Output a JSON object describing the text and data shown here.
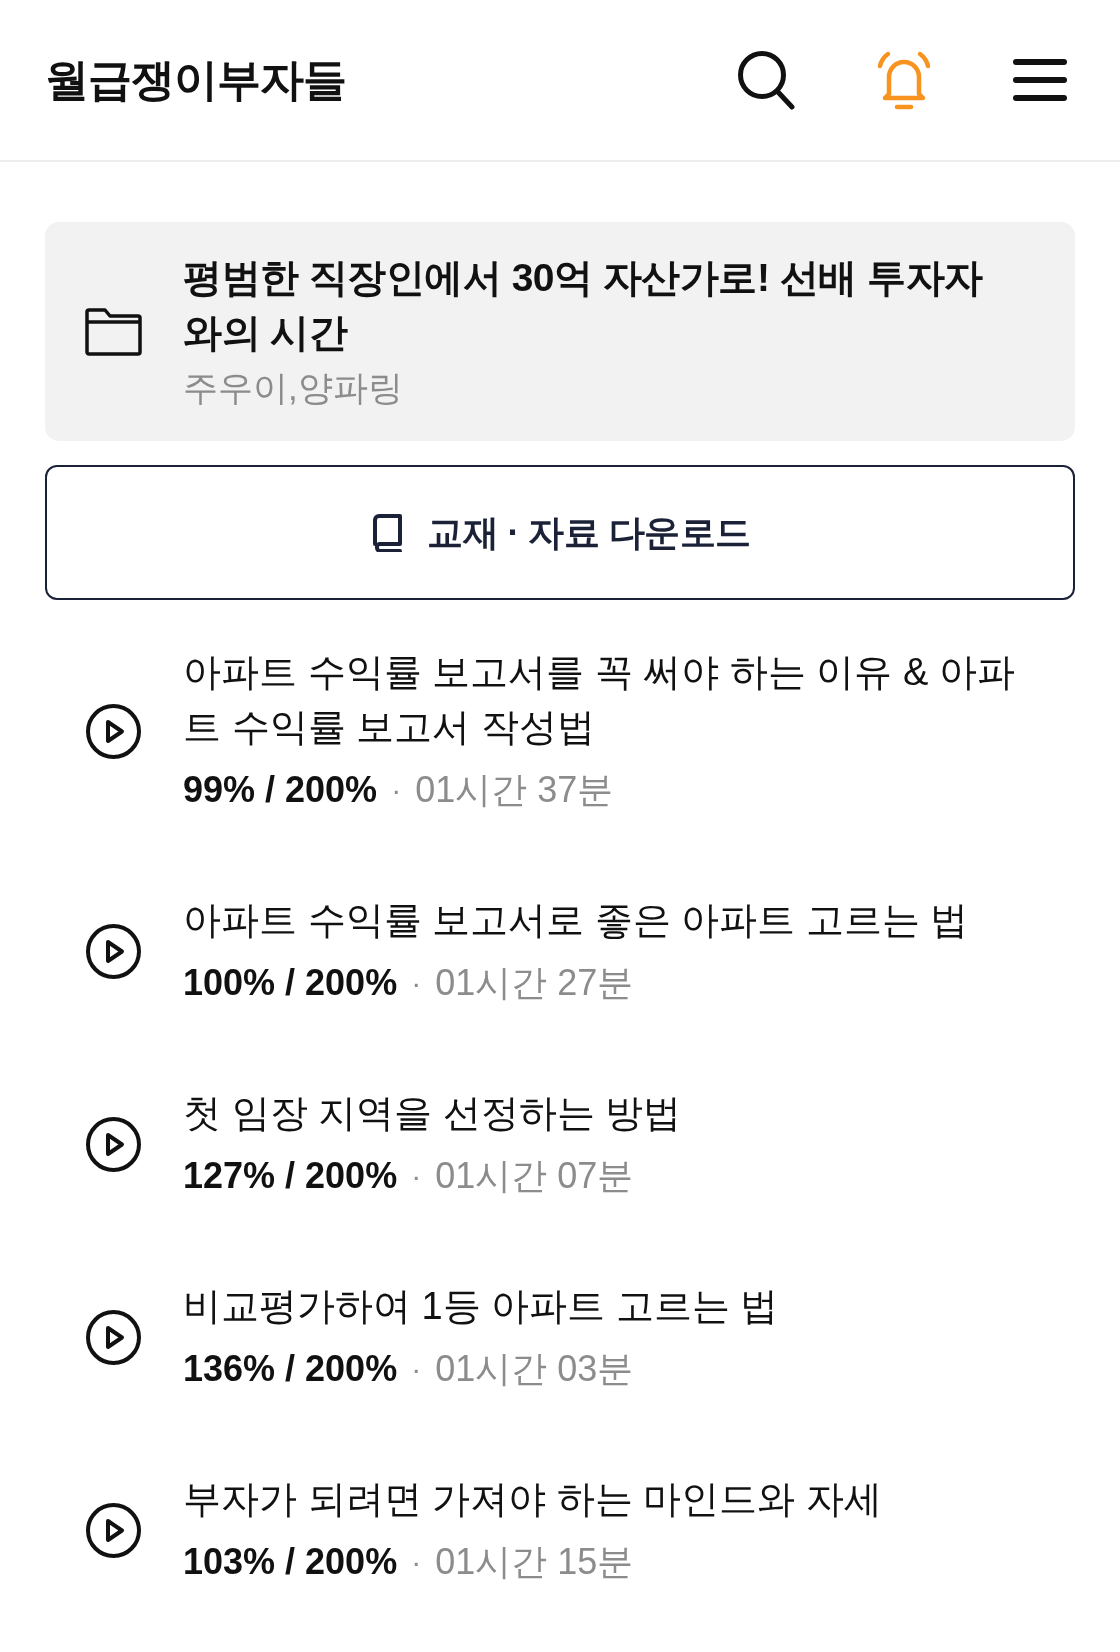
{
  "header": {
    "logo": "월급쟁이부자들"
  },
  "course": {
    "title": "평범한 직장인에서 30억 자산가로! 선배 투자자와의 시간",
    "instructors": "주우이,양파링"
  },
  "download_button": {
    "label": "교재 · 자료 다운로드"
  },
  "lessons": [
    {
      "title": "아파트 수익률 보고서를 꼭 써야 하는 이유 & 아파트 수익률 보고서 작성법",
      "progress": "99% / 200%",
      "separator": "·",
      "duration": "01시간 37분"
    },
    {
      "title": "아파트 수익률 보고서로 좋은 아파트 고르는 법",
      "progress": "100% / 200%",
      "separator": "·",
      "duration": "01시간 27분"
    },
    {
      "title": "첫 임장 지역을 선정하는 방법",
      "progress": "127% / 200%",
      "separator": "·",
      "duration": "01시간 07분"
    },
    {
      "title": "비교평가하여 1등 아파트 고르는 법",
      "progress": "136% / 200%",
      "separator": "·",
      "duration": "01시간 03분"
    },
    {
      "title": "부자가 되려면 가져야 하는 마인드와 자세",
      "progress": "103% / 200%",
      "separator": "·",
      "duration": "01시간 15분"
    }
  ]
}
